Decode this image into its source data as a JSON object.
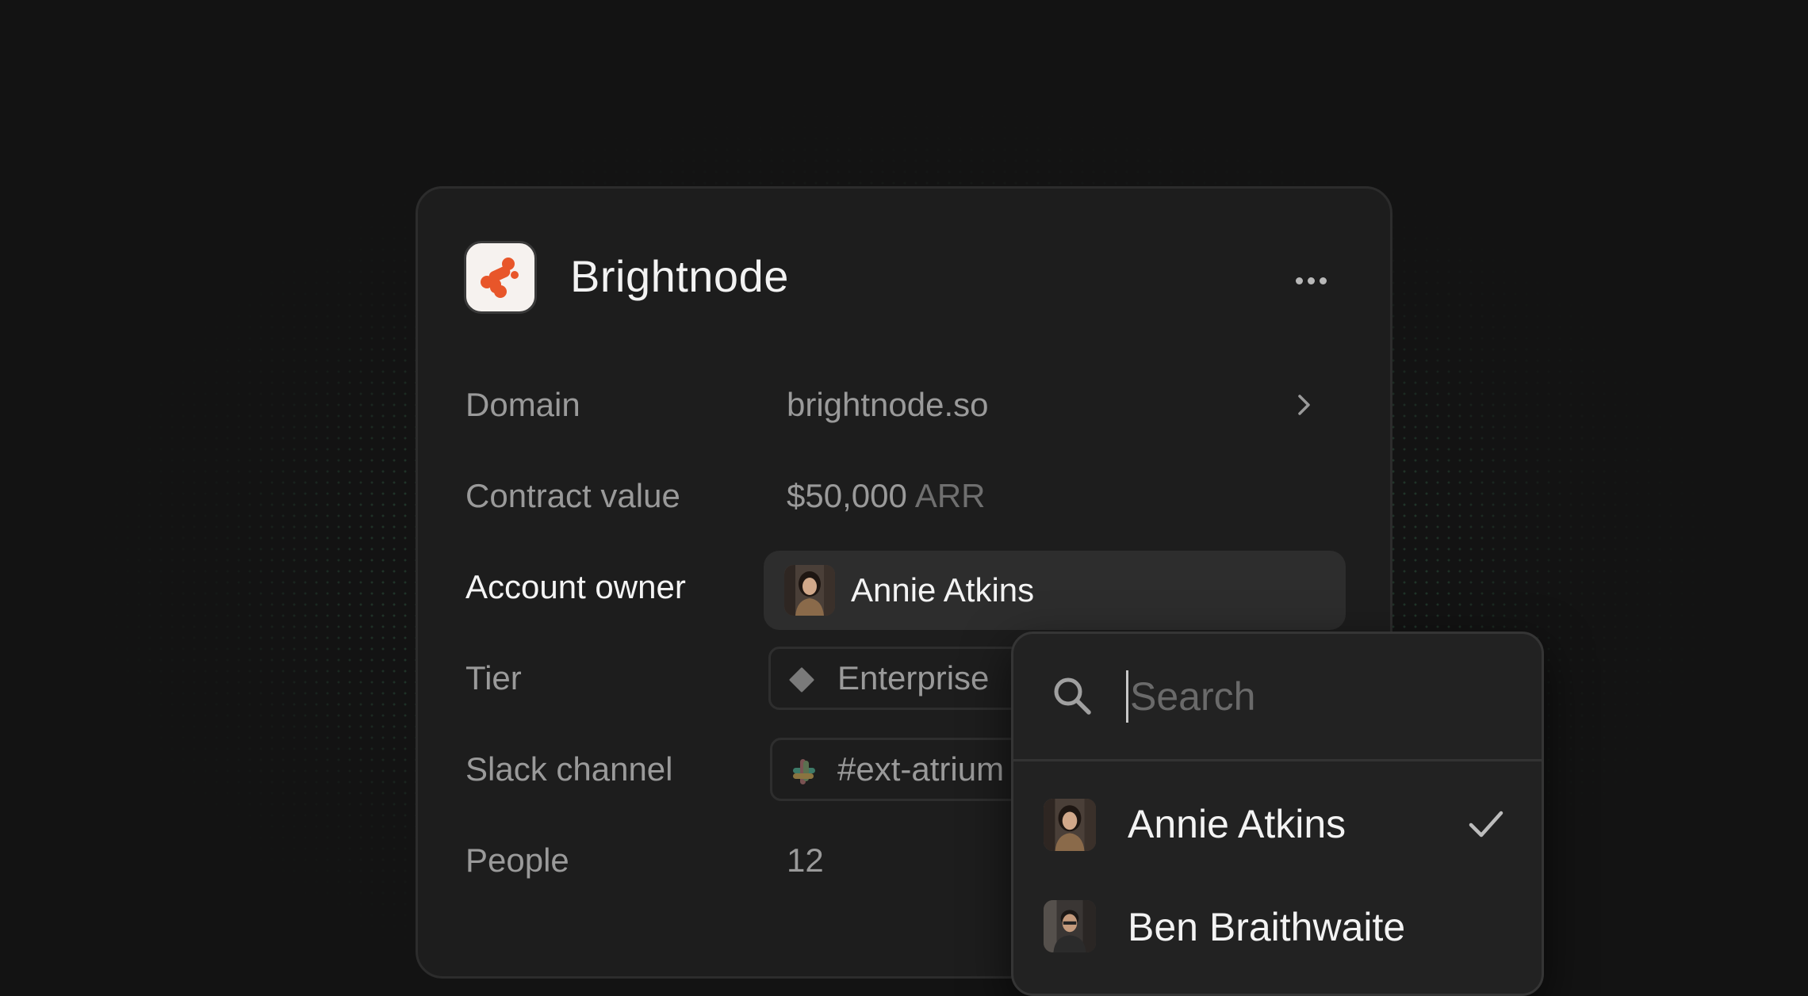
{
  "company": {
    "name": "Brightnode",
    "logo_color": "#e8562a"
  },
  "more_icon": "more-horizontal-icon",
  "fields": {
    "domain": {
      "label": "Domain",
      "value": "brightnode.so"
    },
    "contract_value": {
      "label": "Contract value",
      "amount": "$50,000",
      "unit": "ARR"
    },
    "account_owner": {
      "label": "Account owner",
      "value": "Annie Atkins"
    },
    "tier": {
      "label": "Tier",
      "value": "Enterprise"
    },
    "slack_channel": {
      "label": "Slack channel",
      "value": "#ext-atrium"
    },
    "people": {
      "label": "People",
      "value": "12"
    }
  },
  "dropdown": {
    "search_placeholder": "Search",
    "options": [
      {
        "name": "Annie Atkins",
        "selected": true
      },
      {
        "name": "Ben Braithwaite",
        "selected": false
      }
    ]
  },
  "colors": {
    "background": "#131313",
    "card": "#1d1d1d",
    "accent_dots": "#50aa78",
    "brand": "#e8562a"
  }
}
